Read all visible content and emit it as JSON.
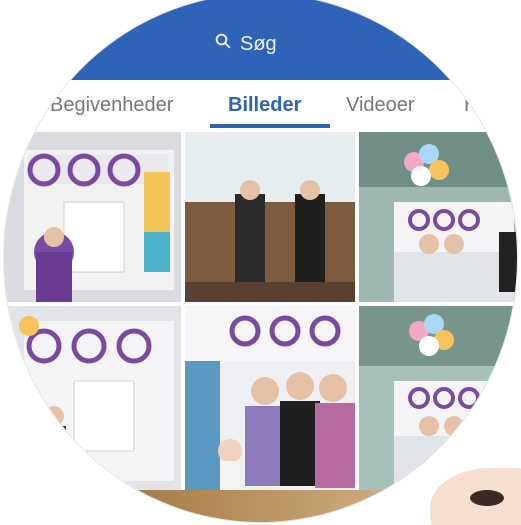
{
  "search": {
    "label": "Søg"
  },
  "tabs": [
    {
      "label": "Begivenheder"
    },
    {
      "label": "Billeder",
      "active": true
    },
    {
      "label": "Videoer"
    },
    {
      "label": "H"
    }
  ],
  "grid": {
    "tiles": [
      {
        "name": "photo-tile-1"
      },
      {
        "name": "photo-tile-2"
      },
      {
        "name": "photo-tile-3"
      },
      {
        "name": "photo-tile-4"
      },
      {
        "name": "photo-tile-5"
      },
      {
        "name": "photo-tile-6"
      }
    ]
  },
  "colors": {
    "brand": "#2f63b8",
    "tab_active": "#2f63b8",
    "tab_inactive": "#777777",
    "poster_purple": "#7a4aa1"
  },
  "icons": {
    "search": "search-icon"
  }
}
